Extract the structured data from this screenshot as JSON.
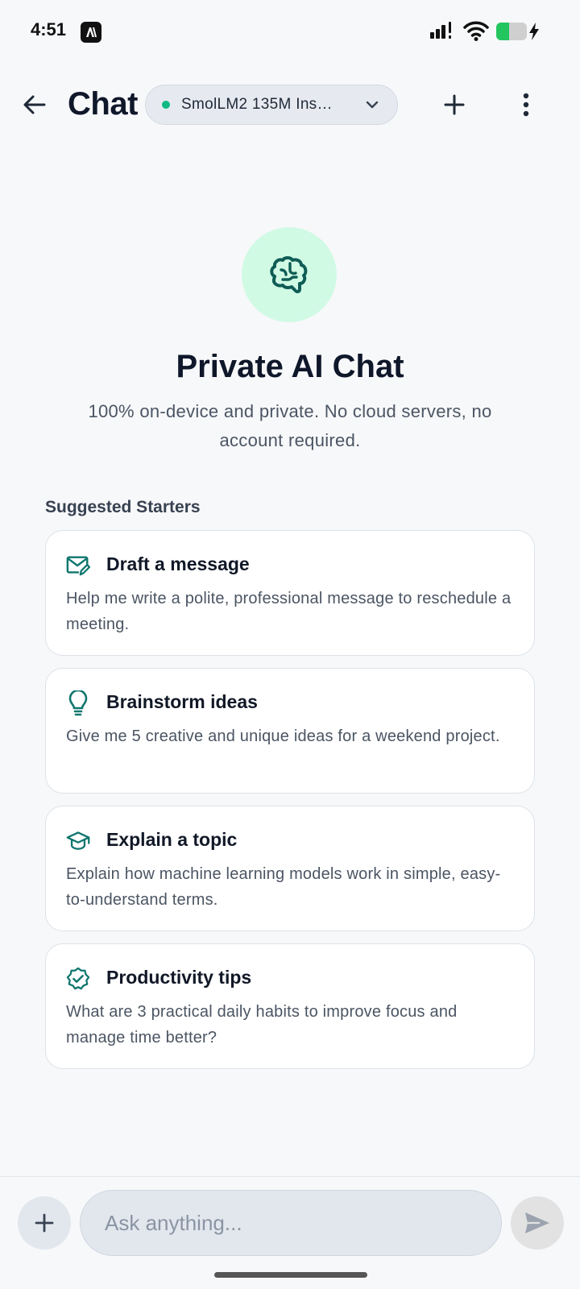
{
  "status_bar": {
    "time": "4:51",
    "battery_level": 0.42,
    "icons": [
      "app-notification-icon",
      "signal-icon",
      "wifi-icon",
      "battery-icon",
      "charging-bolt-icon"
    ]
  },
  "header": {
    "title": "Chat",
    "model_name": "SmolLM2 135M Ins…",
    "model_status_color": "#10b981",
    "back_icon": "arrow-left-icon",
    "new_chat_icon": "plus-icon",
    "more_icon": "more-vertical-icon"
  },
  "hero": {
    "icon": "brain-icon",
    "title": "Private AI Chat",
    "subtitle": "100% on-device and private. No cloud servers, no account required."
  },
  "starters": {
    "section_label": "Suggested Starters",
    "items": [
      {
        "icon": "mail-edit-icon",
        "title": "Draft a message",
        "description": "Help me write a polite, professional message to reschedule a meeting."
      },
      {
        "icon": "lightbulb-icon",
        "title": "Brainstorm ideas",
        "description": "Give me 5 creative and unique ideas for a weekend project."
      },
      {
        "icon": "graduation-cap-icon",
        "title": "Explain a topic",
        "description": "Explain how machine learning models work in simple, easy-to-understand terms."
      },
      {
        "icon": "badge-check-icon",
        "title": "Productivity tips",
        "description": "What are 3 practical daily habits to improve focus and manage time better?"
      }
    ]
  },
  "composer": {
    "placeholder": "Ask anything...",
    "value": "",
    "attach_icon": "plus-icon",
    "send_icon": "send-icon"
  },
  "colors": {
    "accent": "#0f766e",
    "accent_soft": "#d1fae5",
    "background": "#f7f8fa"
  }
}
